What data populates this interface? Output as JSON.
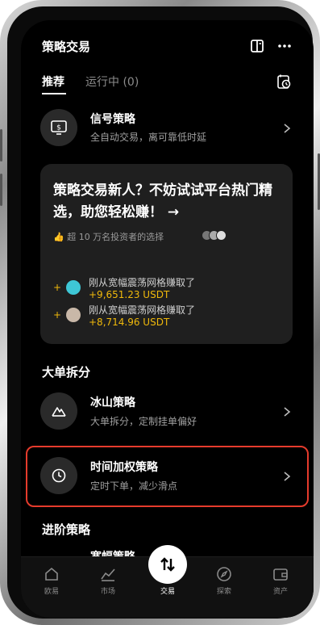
{
  "header": {
    "title": "策略交易"
  },
  "tabs": [
    {
      "label": "推荐"
    },
    {
      "label": "运行中 (0)"
    }
  ],
  "signal": {
    "title": "信号策略",
    "subtitle": "全自动交易，离可靠低时延"
  },
  "promo": {
    "title": "策略交易新人？不妨试试平台热门精选，助您轻松赚！ →",
    "meta": "👍 超 10 万名投资者的选择",
    "feed": [
      {
        "text": "刚从宽幅震荡网格赚取了",
        "amount": "+9,651.23 USDT"
      },
      {
        "text": "刚从宽幅震荡网格赚取了",
        "amount": "+8,714.96 USDT"
      }
    ]
  },
  "sections": {
    "big_order": "大单拆分",
    "advanced": "进阶策略"
  },
  "iceberg": {
    "title": "冰山策略",
    "subtitle": "大单拆分，定制挂单偏好"
  },
  "twap": {
    "title": "时间加权策略",
    "subtitle": "定时下单，减少滑点"
  },
  "partial_row": {
    "title": "宽幅策略"
  },
  "nav": {
    "items": [
      {
        "label": "欧易",
        "icon": "home-icon"
      },
      {
        "label": "市场",
        "icon": "chart-icon"
      },
      {
        "label": "交易",
        "icon": "trade-icon"
      },
      {
        "label": "探索",
        "icon": "compass-icon"
      },
      {
        "label": "资产",
        "icon": "wallet-icon"
      }
    ]
  },
  "colors": {
    "accent": "#f0b90b",
    "highlight": "#e53b2c",
    "background": "#000000",
    "card": "#1f1f1f"
  }
}
